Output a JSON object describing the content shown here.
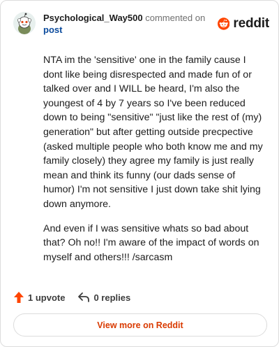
{
  "comment": {
    "username": "Psychological_Way500",
    "commented_on": "commented on",
    "post_link": "post",
    "paragraphs": [
      "NTA im the 'sensitive' one in the family cause I dont like being disrespected and made fun of or talked over and I WILL be heard, I'm also the youngest of 4 by 7 years so I've been reduced down to being \"sensitive\" \"just like the rest of (my) generation\" but after getting outside precpective (asked multiple people who both know me and my family closely) they agree my family is just really mean and think its funny (our dads sense of humor) I'm not sensitive I just down take shit lying down anymore.",
      "And even if I was sensitive whats so bad about that? Oh no!! I'm aware of the impact of words on myself and others!!! /sarcasm"
    ]
  },
  "brand": {
    "wordmark": "reddit",
    "color": "#ff4500"
  },
  "actions": {
    "upvotes": "1 upvote",
    "replies": "0 replies"
  },
  "footer": {
    "view_more_label": "View more on Reddit"
  },
  "icons": {
    "avatar": "snoo-avatar-icon",
    "logo": "reddit-logo-icon",
    "upvote": "upvote-arrow-icon",
    "reply": "reply-arrow-icon"
  }
}
